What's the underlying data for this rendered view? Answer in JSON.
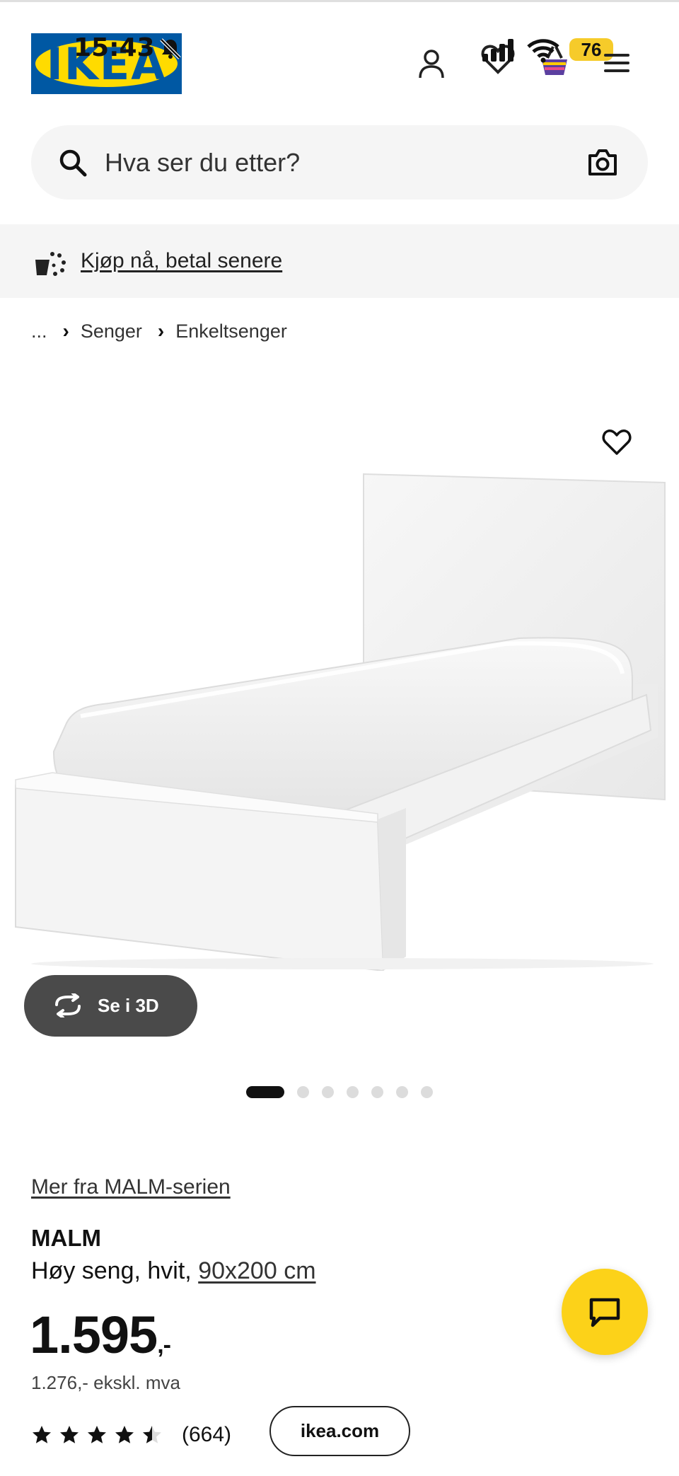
{
  "status": {
    "time": "15:43",
    "battery_level": "76"
  },
  "header": {
    "logo_text": "IKEA",
    "icons": [
      "user-icon",
      "heart-icon",
      "basket-icon",
      "menu-icon"
    ]
  },
  "search": {
    "placeholder": "Hva ser du etter?"
  },
  "promo": {
    "link": "Kjøp nå, betal senere"
  },
  "breadcrumb": {
    "ellipsis": "...",
    "items": [
      "Senger",
      "Enkeltsenger"
    ]
  },
  "gallery": {
    "view_3d_label": "Se i 3D",
    "dot_count": 7,
    "active_dot": 1
  },
  "product": {
    "series_link": "Mer fra MALM-serien",
    "name": "MALM",
    "description": "Høy seng, hvit,",
    "size": "90x200 cm",
    "price_main": "1.595",
    "price_suffix": ",-",
    "price_ex_vat": "1.276,- ekskl. mva",
    "rating": 4.5,
    "review_count": "(664)"
  },
  "footer": {
    "site_label": "ikea.com"
  },
  "colors": {
    "accent_yellow": "#fcd219",
    "ikea_blue": "#0058a3",
    "badge": "#f6cb2a"
  }
}
